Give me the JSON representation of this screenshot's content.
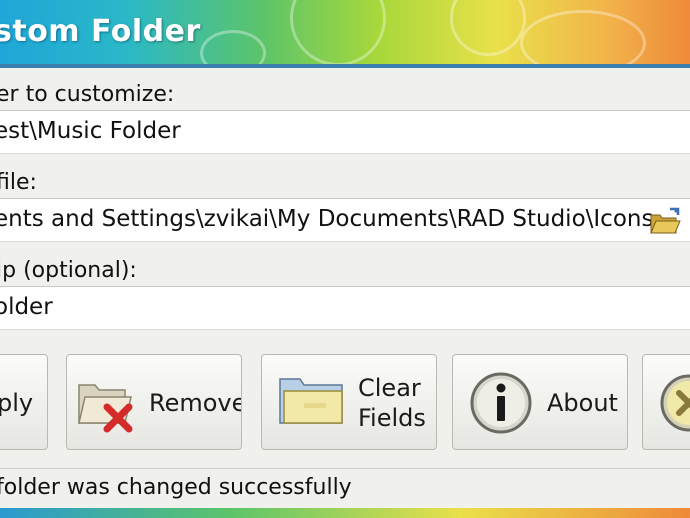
{
  "window": {
    "title": "stom Folder",
    "colors": {
      "banner_start": "#1fa6d8",
      "banner_end": "#ee8a3a",
      "window_bg": "#f0f0ec"
    }
  },
  "form": {
    "folder_label": "er to customize:",
    "folder_value": "est\\Music Folder",
    "icon_label": "file:",
    "icon_value": "ents and Settings\\zvikai\\My Documents\\RAD Studio\\Icons",
    "browse_icon": "folder-open-icon",
    "tip_label": "ip (optional):",
    "tip_value": "older"
  },
  "buttons": {
    "apply": {
      "label": "ply",
      "icon": "apply-icon"
    },
    "remove": {
      "label": "Remove",
      "icon": "folder-remove-icon"
    },
    "clear": {
      "label_line1": "Clear",
      "label_line2": "Fields",
      "icon": "folder-icon"
    },
    "about": {
      "label": "About",
      "icon": "info-icon"
    },
    "close": {
      "icon": "close-icon"
    }
  },
  "status": {
    "text": "folder was changed successfully"
  }
}
